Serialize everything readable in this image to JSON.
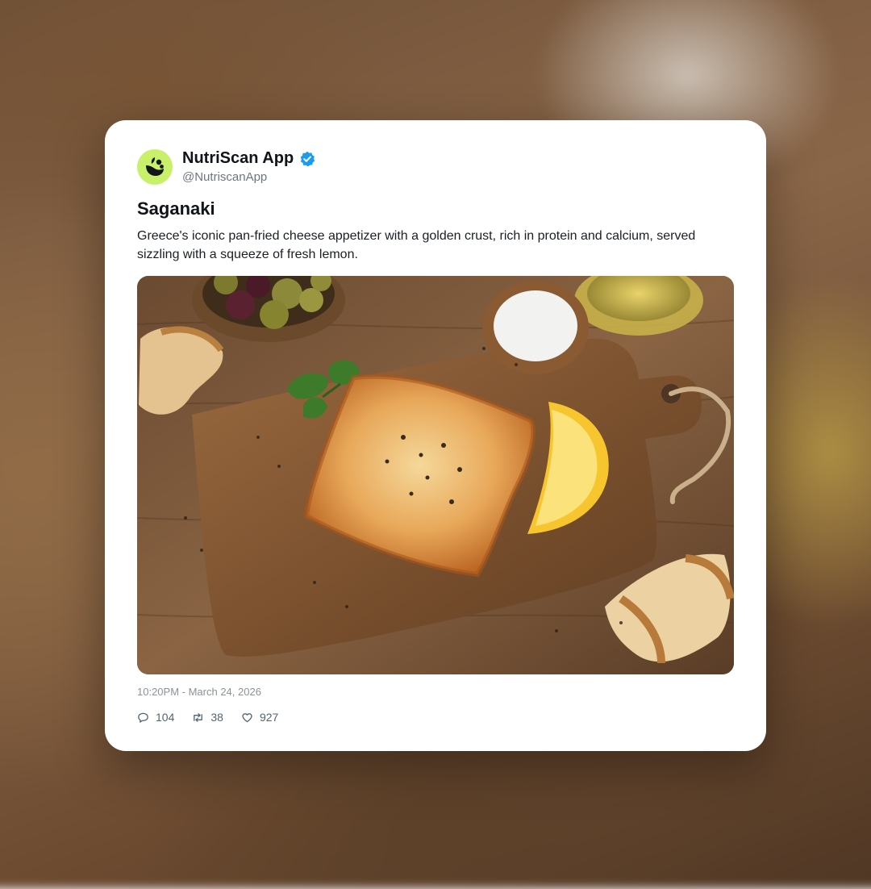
{
  "post": {
    "author": {
      "display_name": "NutriScan App",
      "handle": "@NutriscanApp",
      "verified": true,
      "avatar_icon": "nutriscan-logo-icon",
      "avatar_color": "#c8f06a"
    },
    "title": "Saganaki",
    "body": "Greece's iconic pan-fried cheese appetizer with a golden crust, rich in protein and calcium, served sizzling with a squeeze of fresh lemon.",
    "image_icon": "saganaki-photo",
    "timestamp": "10:20PM - March 24, 2026",
    "stats": {
      "replies": "104",
      "reposts": "38",
      "likes": "927"
    }
  },
  "colors": {
    "accent_verified": "#1d9bf0",
    "card_background": "#ffffff"
  }
}
